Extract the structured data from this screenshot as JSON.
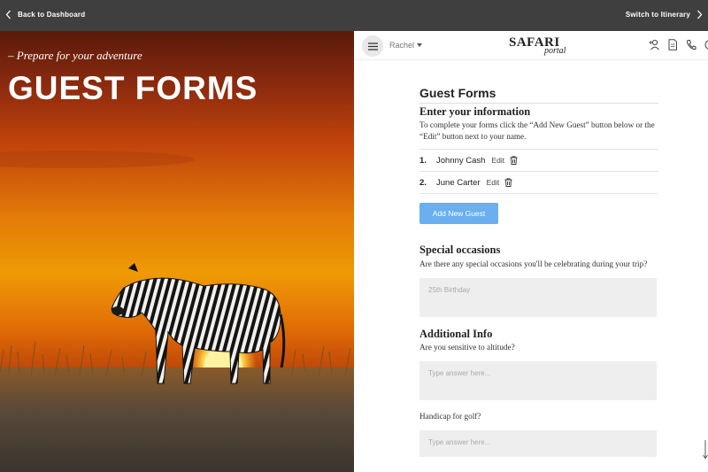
{
  "topbar": {
    "back_label": "Back to Dashboard",
    "switch_label": "Switch to Itinerary"
  },
  "hero": {
    "tagline": "– Prepare for your adventure",
    "title": "GUEST FORMS"
  },
  "header": {
    "user_name": "Rachel",
    "logo_main": "SAFARI",
    "logo_sub": "portal",
    "icons": [
      "add-user-icon",
      "document-icon",
      "phone-icon",
      "chat-icon"
    ]
  },
  "forms": {
    "heading": "Guest Forms",
    "enter_title": "Enter your information",
    "enter_desc": "To complete your forms click the “Add New Guest” button below or the “Edit” button next to your name.",
    "guests": [
      {
        "num": "1.",
        "name": "Johnny Cash",
        "edit": "Edit"
      },
      {
        "num": "2.",
        "name": "June Carter",
        "edit": "Edit"
      }
    ],
    "add_button": "Add New Guest",
    "special_title": "Special occasions",
    "special_question": "Are there any special occasions you'll be celebrating during your trip?",
    "special_placeholder": "25th Birthday",
    "additional_title": "Additional Info",
    "altitude_question": "Are you sensitive to altitude?",
    "altitude_placeholder": "Type answer here...",
    "golf_question": "Handicap for golf?",
    "golf_placeholder": "Type answer here..."
  },
  "colors": {
    "topbar": "#3f3f3f",
    "accent_button": "#6aaff0",
    "field_bg": "#eeeeee"
  }
}
